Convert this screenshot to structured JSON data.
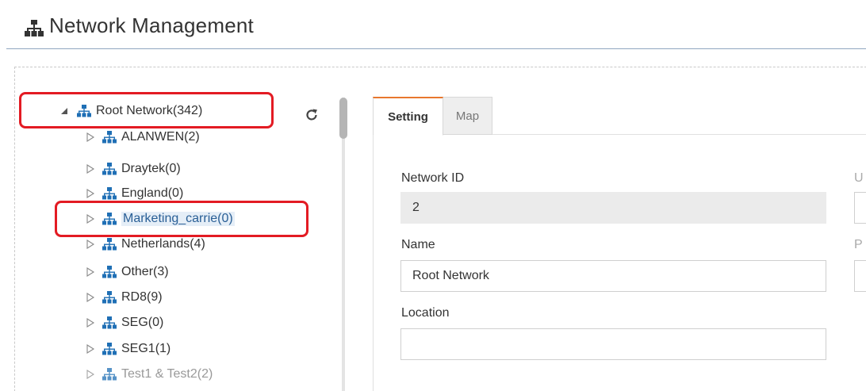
{
  "header": {
    "title": "Network Management",
    "icon": "network-icon"
  },
  "tree": {
    "items": [
      {
        "label": "Root Network(342)",
        "expanded": true
      },
      {
        "label": "ALANWEN(2)"
      },
      {
        "label": "Draytek(0)"
      },
      {
        "label": "England(0)"
      },
      {
        "label": "Marketing_carrie(0)",
        "selected": true
      },
      {
        "label": "Netherlands(4)"
      },
      {
        "label": "Other(3)"
      },
      {
        "label": "RD8(9)"
      },
      {
        "label": "SEG(0)"
      },
      {
        "label": "SEG1(1)"
      },
      {
        "label": "Test1 & Test2(2)"
      }
    ],
    "refresh_icon": "refresh-icon"
  },
  "tabs": [
    {
      "label": "Setting",
      "active": true
    },
    {
      "label": "Map",
      "active": false
    }
  ],
  "form": {
    "network_id": {
      "label": "Network ID",
      "value": "2"
    },
    "name": {
      "label": "Name",
      "value": "Root Network"
    },
    "location": {
      "label": "Location",
      "value": ""
    },
    "cut_label_1": "U",
    "cut_label_2": "P"
  },
  "colors": {
    "highlight_border": "#e31b23",
    "tab_accent": "#e8772e",
    "network_icon": "#1f6fb5",
    "selected_text": "#2a5f96"
  }
}
